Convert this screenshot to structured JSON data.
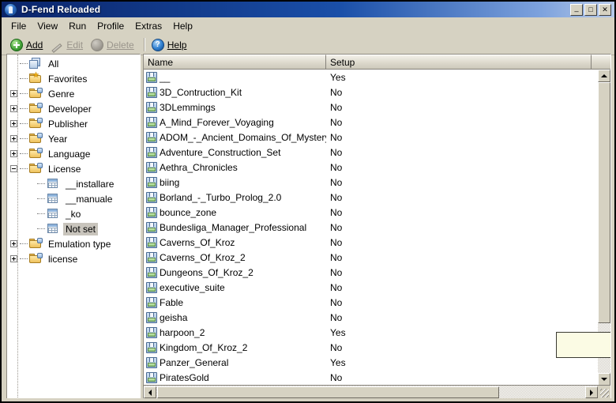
{
  "window": {
    "title": "D-Fend Reloaded",
    "app_icon": "dfend-app-icon",
    "buttons": {
      "minimize": "_",
      "maximize": "□",
      "close": "✕"
    }
  },
  "menubar": {
    "items": [
      {
        "label": "File"
      },
      {
        "label": "View"
      },
      {
        "label": "Run"
      },
      {
        "label": "Profile"
      },
      {
        "label": "Extras"
      },
      {
        "label": "Help"
      }
    ]
  },
  "toolbar": {
    "buttons": [
      {
        "label": "Add",
        "icon": "add-circle-icon",
        "enabled": true
      },
      {
        "label": "Edit",
        "icon": "pencil-icon",
        "enabled": false
      },
      {
        "label": "Delete",
        "icon": "delete-circle-icon",
        "enabled": false
      },
      {
        "label": "Help",
        "icon": "help-circle-icon",
        "enabled": true
      }
    ]
  },
  "tree": {
    "nodes": [
      {
        "label": "All",
        "icon": "stacked-windows-icon",
        "level": 0,
        "expander": "none",
        "selected": false
      },
      {
        "label": "Favorites",
        "icon": "folder-star-icon",
        "level": 0,
        "expander": "none",
        "selected": false
      },
      {
        "label": "Genre",
        "icon": "folder-blue-icon",
        "level": 0,
        "expander": "plus",
        "selected": false
      },
      {
        "label": "Developer",
        "icon": "folder-blue-icon",
        "level": 0,
        "expander": "plus",
        "selected": false
      },
      {
        "label": "Publisher",
        "icon": "folder-blue-icon",
        "level": 0,
        "expander": "plus",
        "selected": false
      },
      {
        "label": "Year",
        "icon": "folder-blue-icon",
        "level": 0,
        "expander": "plus",
        "selected": false
      },
      {
        "label": "Language",
        "icon": "folder-blue-icon",
        "level": 0,
        "expander": "plus",
        "selected": false
      },
      {
        "label": "License",
        "icon": "folder-blue-icon",
        "level": 0,
        "expander": "minus",
        "selected": false
      },
      {
        "label": "__installare",
        "icon": "grid-icon",
        "level": 1,
        "expander": "none",
        "selected": false
      },
      {
        "label": "__manuale",
        "icon": "grid-icon",
        "level": 1,
        "expander": "none",
        "selected": false
      },
      {
        "label": "_ko",
        "icon": "grid-icon",
        "level": 1,
        "expander": "none",
        "selected": false
      },
      {
        "label": "Not set",
        "icon": "grid-icon",
        "level": 1,
        "expander": "none",
        "selected": true
      },
      {
        "label": "Emulation type",
        "icon": "folder-blue-icon",
        "level": 0,
        "expander": "plus",
        "selected": false
      },
      {
        "label": "license",
        "icon": "folder-blue-icon",
        "level": 0,
        "expander": "plus",
        "selected": false
      }
    ]
  },
  "list": {
    "columns": [
      {
        "label": "Name"
      },
      {
        "label": "Setup"
      }
    ],
    "rows": [
      {
        "name": "__",
        "setup": "Yes",
        "icon": "floppy-icon"
      },
      {
        "name": "3D_Contruction_Kit",
        "setup": "No",
        "icon": "floppy-icon"
      },
      {
        "name": "3DLemmings",
        "setup": "No",
        "icon": "floppy-icon"
      },
      {
        "name": "A_Mind_Forever_Voyaging",
        "setup": "No",
        "icon": "floppy-icon"
      },
      {
        "name": "ADOM_-_Ancient_Domains_Of_Mystery",
        "setup": "No",
        "icon": "floppy-icon"
      },
      {
        "name": "Adventure_Construction_Set",
        "setup": "No",
        "icon": "floppy-icon"
      },
      {
        "name": "Aethra_Chronicles",
        "setup": "No",
        "icon": "floppy-icon"
      },
      {
        "name": "biing",
        "setup": "No",
        "icon": "floppy-icon"
      },
      {
        "name": "Borland_-_Turbo_Prolog_2.0",
        "setup": "No",
        "icon": "floppy-icon"
      },
      {
        "name": "bounce_zone",
        "setup": "No",
        "icon": "floppy-icon"
      },
      {
        "name": "Bundesliga_Manager_Professional",
        "setup": "No",
        "icon": "floppy-icon"
      },
      {
        "name": "Caverns_Of_Kroz",
        "setup": "No",
        "icon": "floppy-icon"
      },
      {
        "name": "Caverns_Of_Kroz_2",
        "setup": "No",
        "icon": "floppy-icon"
      },
      {
        "name": "Dungeons_Of_Kroz_2",
        "setup": "No",
        "icon": "floppy-icon"
      },
      {
        "name": "executive_suite",
        "setup": "No",
        "icon": "floppy-icon"
      },
      {
        "name": "Fable",
        "setup": "No",
        "icon": "floppy-icon"
      },
      {
        "name": "geisha",
        "setup": "No",
        "icon": "floppy-icon"
      },
      {
        "name": "harpoon_2",
        "setup": "Yes",
        "icon": "floppy-icon"
      },
      {
        "name": "Kingdom_Of_Kroz_2",
        "setup": "No",
        "icon": "floppy-icon"
      },
      {
        "name": "Panzer_General",
        "setup": "Yes",
        "icon": "floppy-icon"
      },
      {
        "name": "PiratesGold",
        "setup": "No",
        "icon": "floppy-icon"
      }
    ]
  },
  "tooltip": {
    "text": ""
  },
  "colors": {
    "titlebar_start": "#0a246a",
    "titlebar_end": "#b6c9e8",
    "window_face": "#d6d2c2",
    "selection_inactive": "#c8c4bc",
    "tooltip_bg": "#fbfbe4"
  }
}
